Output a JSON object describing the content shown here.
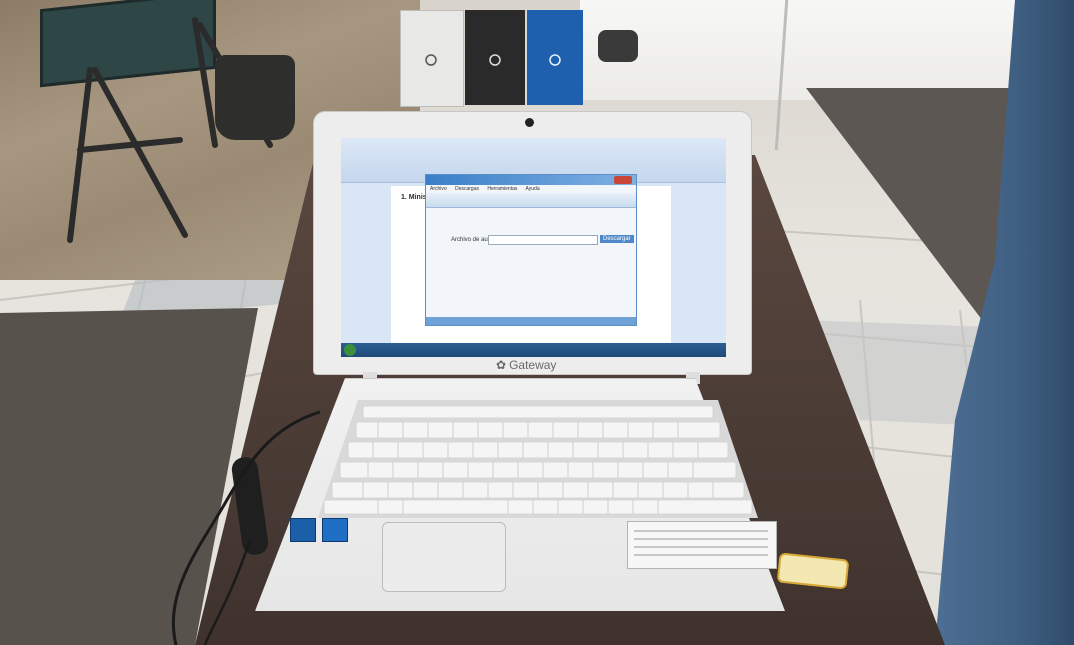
{
  "laptop": {
    "brand": "Gateway"
  },
  "screen": {
    "document_heading": "1. Minis",
    "dialog": {
      "menu_items": [
        "Archivo",
        "Descargas",
        "Herramientas",
        "Ayuda"
      ],
      "field_label": "Archivo de aud",
      "action_button_label": "Descargar"
    }
  },
  "colors": {
    "floor_tile": "#e9e7e2",
    "floor_tile_dark": "#b9bec3",
    "table": "#4a3a33",
    "laptop_body": "#eeeeee",
    "screen_bg": "#d9e6f5",
    "taskbar": "#1f4a7a",
    "dialog_title": "#3a7fc8",
    "mat": "#58524c"
  }
}
